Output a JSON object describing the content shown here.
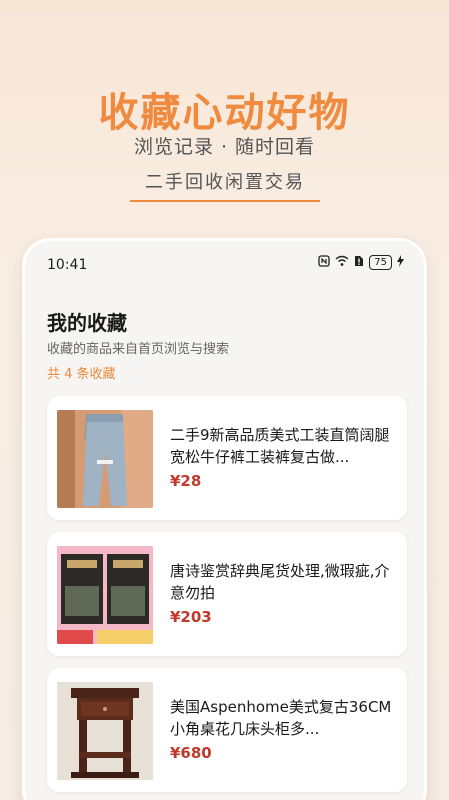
{
  "hero": {
    "title": "收藏心动好物",
    "subtitle": "浏览记录 · 随时回看",
    "tag": "二手回收闲置交易"
  },
  "statusbar": {
    "time": "10:41",
    "battery": "75",
    "icons": [
      "nfc-icon",
      "wifi-icon",
      "sim-alert-icon",
      "battery-icon",
      "charging-icon"
    ]
  },
  "page": {
    "title": "我的收藏",
    "description": "收藏的商品来自首页浏览与搜索",
    "count_label": "共 4 条收藏"
  },
  "items": [
    {
      "title": "二手9新高品质美式工装直筒阔腿宽松牛仔裤工装裤复古做...",
      "price": "¥28",
      "image": "jeans-photo"
    },
    {
      "title": "唐诗鉴赏辞典尾货处理,微瑕疵,介意勿拍",
      "price": "¥203",
      "image": "books-photo",
      "image_labels": [
        "精装典藏",
        "古诗词鉴赏大全"
      ]
    },
    {
      "title": "美国Aspenhome美式复古36CM小角桌花几床头柜多...",
      "price": "¥680",
      "image": "side-table-photo"
    }
  ],
  "colors": {
    "accent": "#f08a3e",
    "price": "#c0392b"
  }
}
